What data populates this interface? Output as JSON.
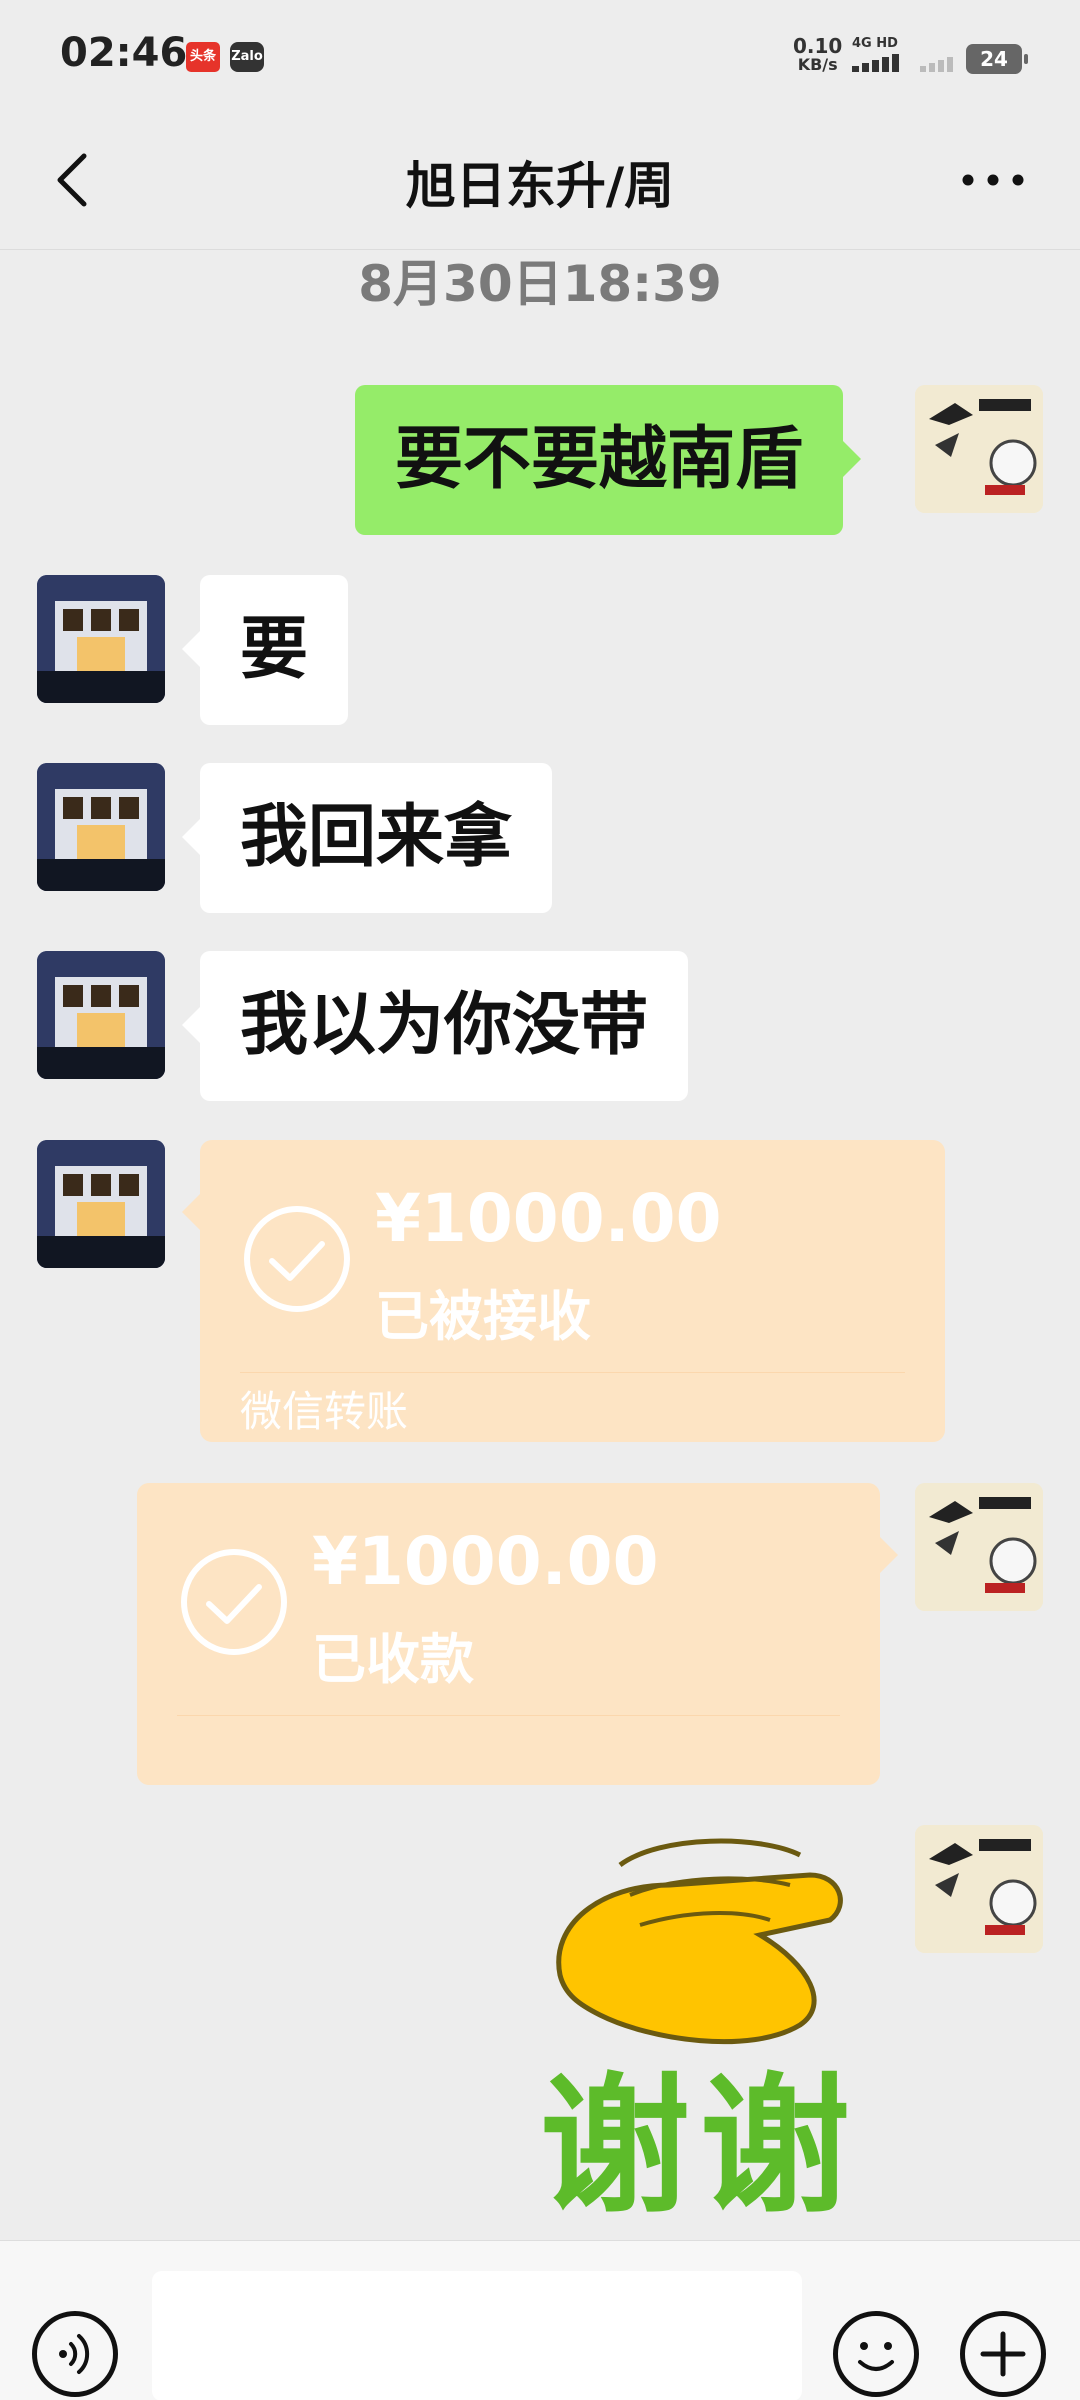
{
  "status_bar": {
    "time": "02:46",
    "app_badges": [
      "头条",
      "Zalo"
    ],
    "net_speed": "0.10",
    "net_speed_unit": "KB/s",
    "net_type": "4G HD",
    "battery": "24"
  },
  "header": {
    "title": "旭日东升/周",
    "back_icon": "chevron-left-icon",
    "more_icon": "more-dots-icon"
  },
  "timestamp": "8月30日18:39",
  "messages": [
    {
      "side": "out",
      "type": "text",
      "text": "要不要越南盾"
    },
    {
      "side": "in",
      "type": "text",
      "text": "要"
    },
    {
      "side": "in",
      "type": "text",
      "text": "我回来拿"
    },
    {
      "side": "in",
      "type": "text",
      "text": "我以为你没带"
    },
    {
      "side": "in",
      "type": "transfer",
      "amount": "¥1000.00",
      "status": "已被接收",
      "source": "微信转账"
    },
    {
      "side": "out",
      "type": "transfer",
      "amount": "¥1000.00",
      "status": "已收款",
      "source": ""
    },
    {
      "side": "out",
      "type": "sticker",
      "text": "谢谢"
    }
  ],
  "colors": {
    "background": "#ededed",
    "outgoing_bubble": "#95ec69",
    "incoming_bubble": "#ffffff",
    "transfer_card": "#fde4c4",
    "sticker_text": "#5dbb2a"
  },
  "input_bar": {
    "voice_icon": "voice-icon",
    "emoji_icon": "emoji-icon",
    "plus_icon": "plus-icon",
    "placeholder": ""
  }
}
